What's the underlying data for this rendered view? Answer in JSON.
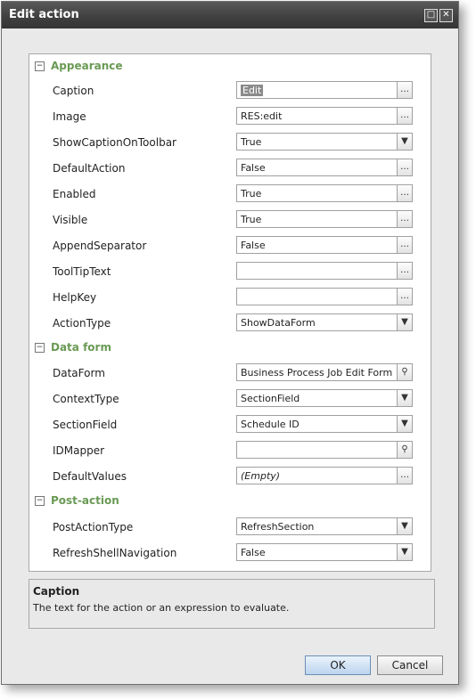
{
  "dialog": {
    "title": "Edit action"
  },
  "categories": {
    "appearance": "Appearance",
    "data_form": "Data form",
    "post_action": "Post-action"
  },
  "properties": {
    "caption": {
      "name": "Caption",
      "value": "Edit"
    },
    "image": {
      "name": "Image",
      "value": "RES:edit"
    },
    "show_caption": {
      "name": "ShowCaptionOnToolbar",
      "value": "True"
    },
    "default_action": {
      "name": "DefaultAction",
      "value": "False"
    },
    "enabled": {
      "name": "Enabled",
      "value": "True"
    },
    "visible": {
      "name": "Visible",
      "value": "True"
    },
    "append_separator": {
      "name": "AppendSeparator",
      "value": "False"
    },
    "tooltip": {
      "name": "ToolTipText",
      "value": ""
    },
    "helpkey": {
      "name": "HelpKey",
      "value": ""
    },
    "action_type": {
      "name": "ActionType",
      "value": "ShowDataForm"
    },
    "dataform": {
      "name": "DataForm",
      "value": "Business Process Job Edit Form"
    },
    "context_type": {
      "name": "ContextType",
      "value": "SectionField"
    },
    "section_field": {
      "name": "SectionField",
      "value": "Schedule ID"
    },
    "idmapper": {
      "name": "IDMapper",
      "value": ""
    },
    "default_values": {
      "name": "DefaultValues",
      "value": "(Empty)"
    },
    "post_action_type": {
      "name": "PostActionType",
      "value": "RefreshSection"
    },
    "refresh_shell": {
      "name": "RefreshShellNavigation",
      "value": "False"
    }
  },
  "help": {
    "title": "Caption",
    "description": "The text for the action or an expression to evaluate."
  },
  "buttons": {
    "ok": "OK",
    "cancel": "Cancel"
  },
  "icons": {
    "expand": "minus-box-icon",
    "ellipsis": "ellipsis-icon",
    "dropdown": "chevron-down-icon",
    "search": "search-icon"
  },
  "colors": {
    "category": "#6a9a55",
    "titlebar": "#3f3f3f"
  }
}
